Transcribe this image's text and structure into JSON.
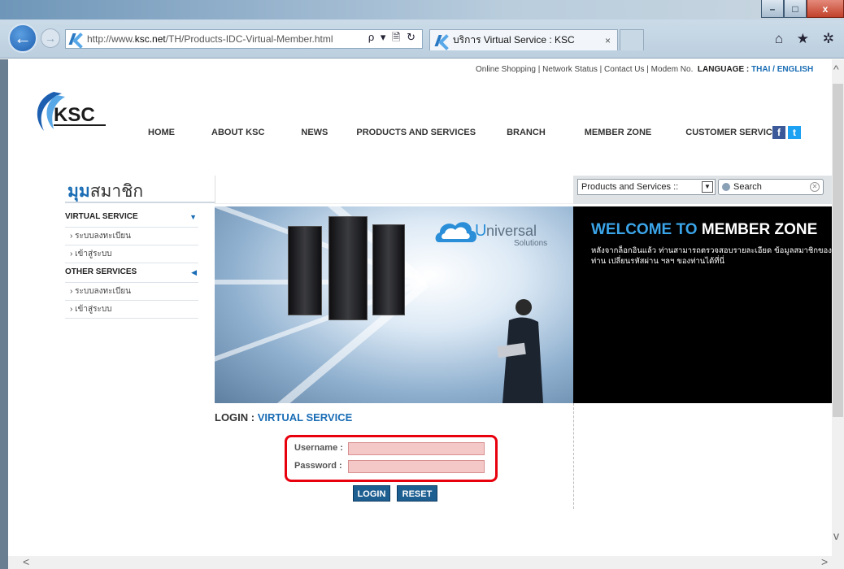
{
  "browser": {
    "url_prefix": "http://www.",
    "url_domain": "ksc.net",
    "url_suffix": "/TH/Products-IDC-Virtual-Member.html",
    "tab_title": "บริการ Virtual Service : KSC",
    "tab_close": "×",
    "minimize": "–",
    "maximize": "□",
    "close": "x",
    "back": "←",
    "forward": "→",
    "addr_icons": "ρ ▾ 🗎 ↻",
    "right_icons": "⌂ ★ ✲"
  },
  "toplinks": {
    "text": "Online Shopping | Network Status | Contact Us | Modem No.",
    "language_label": "LANGUAGE :",
    "thai": "THAI",
    "sep": "/",
    "english": "ENGLISH"
  },
  "nav": {
    "home": "HOME",
    "about": "ABOUT KSC",
    "news": "NEWS",
    "products": "PRODUCTS AND SERVICES",
    "branch": "BRANCH",
    "member": "MEMBER ZONE",
    "customer": "CUSTOMER SERVICE"
  },
  "social": {
    "facebook": "f",
    "twitter": "t"
  },
  "sidebar": {
    "title_bold": "มุม",
    "title_rest": "สมาชิก",
    "sections": [
      {
        "label": "VIRTUAL SERVICE",
        "caret": "▼",
        "items": [
          "ระบบลงทะเบียน",
          "เข้าสู่ระบบ"
        ]
      },
      {
        "label": "OTHER SERVICES",
        "caret": "◀",
        "items": [
          "ระบบลงทะเบียน",
          "เข้าสู่ระบบ"
        ]
      }
    ]
  },
  "search": {
    "select_value": "Products and Services ::",
    "placeholder": "Search"
  },
  "hero": {
    "brand": "niversal",
    "brand_initial": "U",
    "brand_sub": "Solutions"
  },
  "welcome": {
    "w1": "WELCOME",
    "w2": "TO",
    "w3": "MEMBER ZONE",
    "text": "หลังจากล็อกอินแล้ว ท่านสามารถตรวจสอบรายละเอียด ข้อมูลสมาชิกของท่าน เปลี่ยนรหัสผ่าน ฯลฯ ของท่านได้ที่นี่"
  },
  "login": {
    "title_prefix": "LOGIN :",
    "title_service": "VIRTUAL SERVICE",
    "username_label": "Username :",
    "password_label": "Password :",
    "login_btn": "LOGIN",
    "reset_btn": "RESET"
  },
  "colors": {
    "accent": "#1a6db5",
    "highlight": "#e8000d",
    "button": "#1e5f92"
  }
}
